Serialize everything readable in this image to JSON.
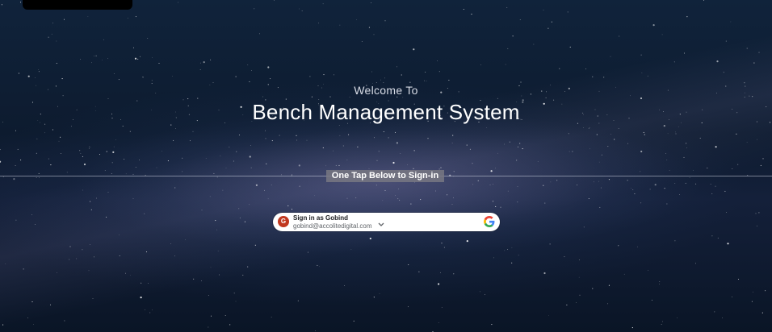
{
  "header": {
    "welcome": "Welcome To",
    "title": "Bench Management System"
  },
  "divider": {
    "label": "One Tap Below to Sign-in"
  },
  "signin": {
    "initial": "G",
    "name_line": "Sign in as Gobind",
    "email": "gobind@accolitedigital.com",
    "provider_icon": "google-icon",
    "avatar_color": "#c1381f"
  },
  "icons": {
    "chevron": "chevron-down-icon"
  }
}
